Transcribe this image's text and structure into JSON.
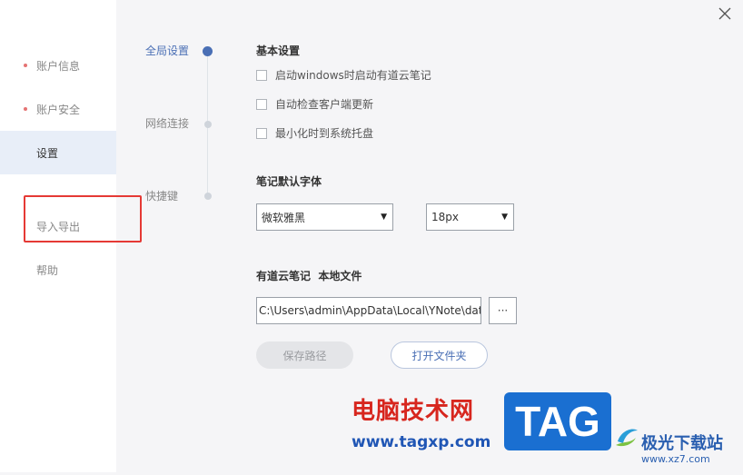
{
  "sidebar": {
    "items": [
      {
        "label": "账户信息"
      },
      {
        "label": "账户安全"
      },
      {
        "label": "设置"
      },
      {
        "label": "导入导出"
      },
      {
        "label": "帮助"
      }
    ]
  },
  "timeline": {
    "steps": [
      {
        "label": "全局设置"
      },
      {
        "label": "网络连接"
      },
      {
        "label": "快捷键"
      }
    ]
  },
  "basic": {
    "title": "基本设置",
    "options": [
      {
        "label": "启动windows时启动有道云笔记",
        "checked": false
      },
      {
        "label": "自动检查客户端更新",
        "checked": false
      },
      {
        "label": "最小化时到系统托盘",
        "checked": false
      }
    ]
  },
  "font": {
    "title": "笔记默认字体",
    "family": "微软雅黑",
    "size": "18px"
  },
  "storage": {
    "title": "有道云笔记  本地文件",
    "path": "C:\\Users\\admin\\AppData\\Local\\YNote\\dat",
    "browse_label": "···",
    "save_label": "保存路径",
    "open_label": "打开文件夹"
  },
  "watermark": {
    "cn_text": "电脑技术网",
    "url": "www.tagxp.com",
    "tag": "TAG",
    "site": "极光下载站",
    "site_url": "www.xz7.com"
  },
  "colors": {
    "accent": "#4a6fb5",
    "highlight": "#e53935"
  }
}
